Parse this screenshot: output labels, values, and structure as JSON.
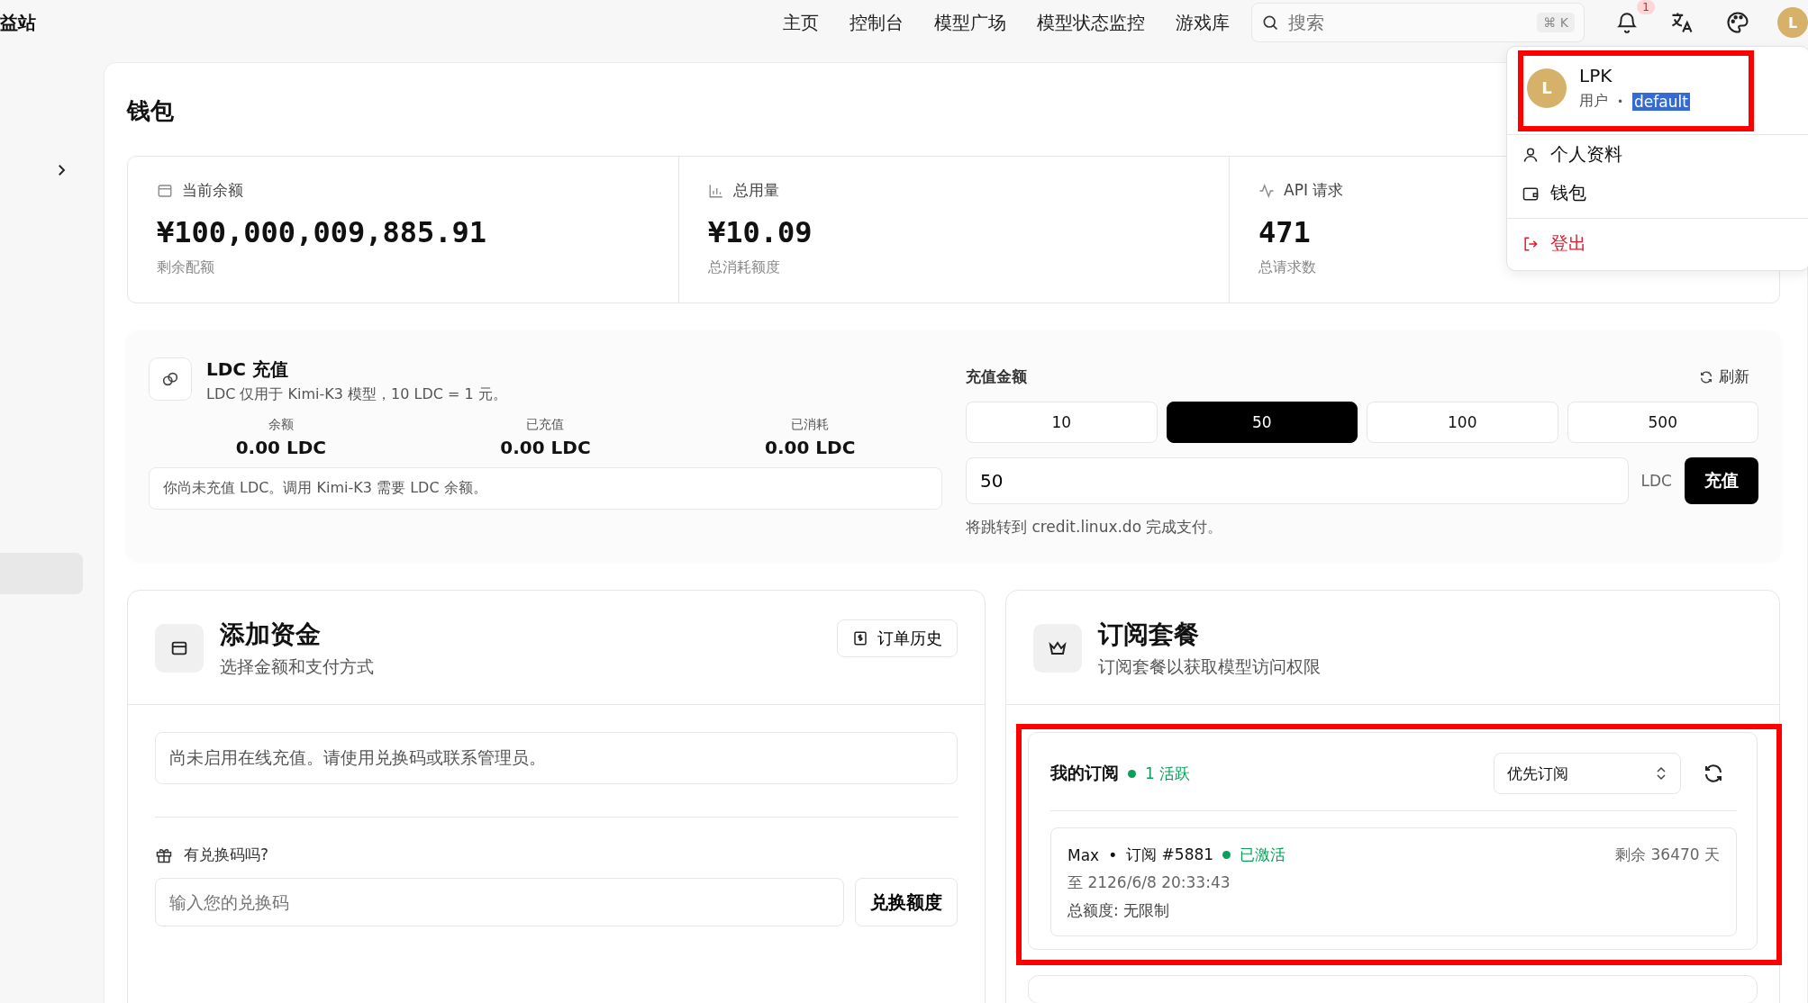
{
  "brand": "益站",
  "nav": [
    {
      "label": "主页"
    },
    {
      "label": "控制台"
    },
    {
      "label": "模型广场"
    },
    {
      "label": "模型状态监控"
    },
    {
      "label": "游戏库"
    }
  ],
  "search": {
    "placeholder": "搜索",
    "shortcut": "⌘ K"
  },
  "notifications": {
    "count": "1"
  },
  "avatar": "L",
  "user_menu": {
    "avatar": "L",
    "name": "LPK",
    "role": "用户",
    "separator": "•",
    "group": "default",
    "group_selected": true,
    "highlighted": true,
    "items": [
      {
        "label": "个人资料",
        "kind": "profile"
      },
      {
        "label": "钱包",
        "kind": "wallet"
      },
      {
        "label": "登出",
        "kind": "logout"
      }
    ]
  },
  "wallet": {
    "title": "钱包",
    "stats": [
      {
        "kind": "balance",
        "label": "当前余额",
        "value": "¥100,000,009,885.91",
        "caption": "剩余配额"
      },
      {
        "kind": "usage",
        "label": "总用量",
        "value": "¥10.09",
        "caption": "总消耗额度"
      },
      {
        "kind": "requests",
        "label": "API 请求",
        "value": "471",
        "caption": "总请求数"
      }
    ]
  },
  "ldc": {
    "title": "LDC 充值",
    "description": "LDC 仅用于 Kimi-K3 模型，10 LDC = 1 元。",
    "stats": [
      {
        "label": "余额",
        "value": "0.00 LDC"
      },
      {
        "label": "已充值",
        "value": "0.00 LDC"
      },
      {
        "label": "已消耗",
        "value": "0.00 LDC"
      }
    ],
    "notice": "你尚未充值 LDC。调用 Kimi-K3 需要 LDC 余额。",
    "amount_label": "充值金额",
    "refresh": "刷新",
    "presets": [
      {
        "label": "10",
        "selected": false
      },
      {
        "label": "50",
        "selected": true
      },
      {
        "label": "100",
        "selected": false
      },
      {
        "label": "500",
        "selected": false
      }
    ],
    "amount_value": "50",
    "unit": "LDC",
    "submit": "充值",
    "hint": "将跳转到 credit.linux.do 完成支付。"
  },
  "add_funds": {
    "title": "添加资金",
    "subtitle": "选择金额和支付方式",
    "history_button": "订单历史",
    "notice": "尚未启用在线充值。请使用兑换码或联系管理员。",
    "redeem_label": "有兑换码吗?",
    "redeem_placeholder": "输入您的兑换码",
    "redeem_button": "兑换额度"
  },
  "subscriptions": {
    "title": "订阅套餐",
    "subtitle": "订阅套餐以获取模型访问权限",
    "highlighted": true,
    "my_label": "我的订阅",
    "active_badge": "1 活跃",
    "sort": "优先订阅",
    "items": [
      {
        "plan": "Max",
        "separator": "•",
        "id": "订阅 #5881",
        "status": "已激活",
        "remaining": "剩余 36470 天",
        "expiry": "至 2126/6/8 20:33:43",
        "quota": "总额度: 无限制"
      }
    ]
  }
}
